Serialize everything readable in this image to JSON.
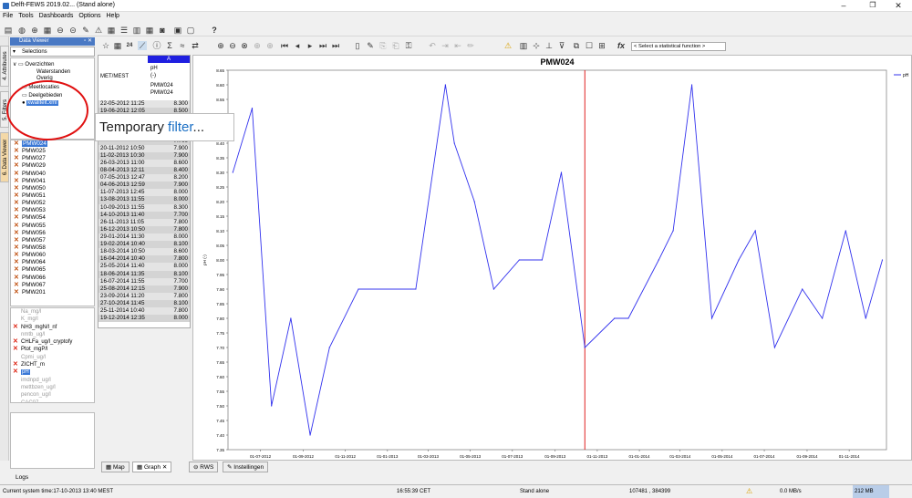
{
  "window": {
    "title": "Delft-FEWS 2019.02...  (Stand alone)",
    "controls": [
      "–",
      "❐",
      "✕"
    ]
  },
  "menu": [
    "File",
    "Tools",
    "Dashboards",
    "Options",
    "Help"
  ],
  "data_viewer": {
    "title": "Data Viewer",
    "selection_label": "Selections"
  },
  "side_tabs": [
    "4. Attributes",
    "5. Filters",
    "6. Data Viewer"
  ],
  "tree": {
    "overzichten": "Overzichten",
    "waterstanden": "Waterstanden",
    "overig": "Overig",
    "meetlocaties": "Meetlocaties",
    "deelgebieden": "Deelgebieden",
    "kwaliteit": "kwaliteit.xml"
  },
  "tooltip": {
    "prefix": "Temporary ",
    "highlight": "filter",
    "suffix": "..."
  },
  "locations": [
    "PMW024",
    "PMW025",
    "PMW027",
    "PMW029",
    "PMW040",
    "PMW041",
    "PMW050",
    "PMW051",
    "PMW052",
    "PMW053",
    "PMW054",
    "PMW055",
    "PMW056",
    "PMW057",
    "PMW058",
    "PMW060",
    "PMW064",
    "PMW065",
    "PMW066",
    "PMW067",
    "PMW201"
  ],
  "parameters": [
    {
      "name": "Na_mg/l",
      "state": "grey"
    },
    {
      "name": "K_mg/l",
      "state": "grey"
    },
    {
      "name": "NH3_mgN/l_nf",
      "state": "x"
    },
    {
      "name": "nmtb_ug/l",
      "state": "grey"
    },
    {
      "name": "CHLFa_ug/l_cryptofy",
      "state": "x"
    },
    {
      "name": "Ptot_mgP/l",
      "state": "x"
    },
    {
      "name": "Cpmi_ug/l",
      "state": "grey"
    },
    {
      "name": "ZICHT_m",
      "state": "x"
    },
    {
      "name": "pH",
      "state": "sel"
    },
    {
      "name": "imdnpd_ug/l",
      "state": "grey"
    },
    {
      "name": "mettbzen_ug/l",
      "state": "grey"
    },
    {
      "name": "pencon_ug/l",
      "state": "grey"
    },
    {
      "name": "CAC07",
      "state": "grey"
    }
  ],
  "table": {
    "col_a": "A",
    "h_loc": "MET/MEST",
    "h_param": "pH",
    "h_unit": "(-)",
    "h_loc1": "PMW024",
    "h_loc2": "PMW024",
    "rows": [
      [
        "22-05-2012 11:25",
        "8.300"
      ],
      [
        "19-06-2012 12:05",
        "8.500"
      ],
      [
        "",
        "7.900"
      ],
      [
        "",
        "7.400"
      ],
      [
        "",
        "7.800"
      ],
      [
        "",
        "7.700"
      ],
      [
        "20-11-2012 10:50",
        "7.900"
      ],
      [
        "11-02-2013 10:30",
        "7.900"
      ],
      [
        "26-03-2013 11:00",
        "8.600"
      ],
      [
        "08-04-2013 12:11",
        "8.400"
      ],
      [
        "07-05-2013 12:47",
        "8.200"
      ],
      [
        "04-06-2013 12:59",
        "7.900"
      ],
      [
        "11-07-2013 12:45",
        "8.000"
      ],
      [
        "13-08-2013 11:55",
        "8.000"
      ],
      [
        "10-09-2013 11:55",
        "8.300"
      ],
      [
        "14-10-2013 11:40",
        "7.700"
      ],
      [
        "26-11-2013 11:05",
        "7.800"
      ],
      [
        "16-12-2013 10:50",
        "7.800"
      ],
      [
        "29-01-2014 11:30",
        "8.000"
      ],
      [
        "19-02-2014 10:40",
        "8.100"
      ],
      [
        "18-03-2014 10:50",
        "8.600"
      ],
      [
        "16-04-2014 10:40",
        "7.800"
      ],
      [
        "25-05-2014 11:40",
        "8.000"
      ],
      [
        "18-06-2014 11:35",
        "8.100"
      ],
      [
        "16-07-2014 11:55",
        "7.700"
      ],
      [
        "25-08-2014 12:15",
        "7.900"
      ],
      [
        "23-09-2014 11:20",
        "7.800"
      ],
      [
        "27-10-2014 11:45",
        "8.100"
      ],
      [
        "25-11-2014 10:40",
        "7.800"
      ],
      [
        "19-12-2014 12:35",
        "8.000"
      ]
    ]
  },
  "toolbar2": {
    "zoom": "24",
    "stat_label": "fx",
    "stat_select": "< Select a statistical function >"
  },
  "chart_data": {
    "type": "line",
    "title": "PMW024",
    "ylabel": "pH (-)",
    "legend": [
      "pH"
    ],
    "legend_position": "top-right",
    "ylim": [
      7.35,
      8.65
    ],
    "yticks": [
      "7.35",
      "7.40",
      "7.45",
      "7.50",
      "7.55",
      "7.60",
      "7.65",
      "7.70",
      "7.75",
      "7.80",
      "7.85",
      "7.90",
      "7.95",
      "8.00",
      "8.05",
      "8.10",
      "8.15",
      "8.20",
      "8.25",
      "8.30",
      "8.35",
      "8.40",
      "8.45",
      "8.50",
      "8.55",
      "8.60",
      "8.65"
    ],
    "xticks": [
      "01-07-2012",
      "01-09-2012",
      "01-11-2012",
      "01-01-2013",
      "01-03-2013",
      "01-05-2013",
      "01-07-2013",
      "01-09-2013",
      "01-11-2013",
      "01-01-2014",
      "01-03-2014",
      "01-05-2014",
      "01-07-2014",
      "01-09-2014",
      "01-11-2014"
    ],
    "x": [
      "2012-05-22",
      "2012-06-19",
      "2012-07-17",
      "2012-08-14",
      "2012-09-11",
      "2012-10-09",
      "2012-11-20",
      "2013-02-11",
      "2013-03-26",
      "2013-04-08",
      "2013-05-07",
      "2013-06-04",
      "2013-07-11",
      "2013-08-13",
      "2013-09-10",
      "2013-10-14",
      "2013-11-26",
      "2013-12-16",
      "2014-01-29",
      "2014-02-19",
      "2014-03-18",
      "2014-04-16",
      "2014-05-25",
      "2014-06-18",
      "2014-07-16",
      "2014-08-25",
      "2014-09-23",
      "2014-10-27",
      "2014-11-25",
      "2014-12-19"
    ],
    "values": [
      8.3,
      8.52,
      7.5,
      7.8,
      7.4,
      7.7,
      7.9,
      7.9,
      8.6,
      8.4,
      8.2,
      7.9,
      8.0,
      8.0,
      8.3,
      7.7,
      7.8,
      7.8,
      8.0,
      8.1,
      8.6,
      7.8,
      8.0,
      8.1,
      7.7,
      7.9,
      7.8,
      8.1,
      7.8,
      8.0
    ],
    "marker_date": "2013-10-14",
    "series_color": "#3333ee",
    "marker_color": "#e02020"
  },
  "bottom_tabs": [
    "Map",
    "Graph",
    "RWS",
    "Instellingen"
  ],
  "logs_label": "Logs",
  "status": {
    "time": "Current system time:17-10-2013 13:40 MEST",
    "clock": "16:55:39 CET",
    "mode": "Stand alone",
    "coords": "107481 , 384399",
    "rate": "0.0 MB/s",
    "mem": "212 MB"
  }
}
